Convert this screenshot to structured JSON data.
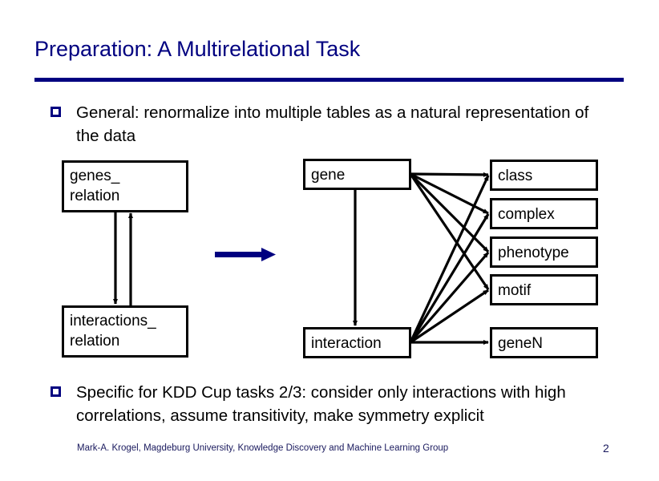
{
  "slide": {
    "title": "Preparation: A Multirelational Task",
    "accent_color": "#000080",
    "line_color": "#000000",
    "background": "#ffffff"
  },
  "bullets": [
    {
      "marker": "hollow-square",
      "text": "General: renormalize into multiple tables as a natural representation of the data"
    },
    {
      "marker": "hollow-square",
      "text": "Specific for KDD Cup tasks 2/3: consider only interactions with high correlations, assume transitivity, make symmetry explicit"
    }
  ],
  "diagram": {
    "transform_arrow": "arrow-right",
    "boxes": [
      {
        "id": "genes_relation",
        "label_line1": "genes_",
        "label_line2": "relation"
      },
      {
        "id": "interactions_relation",
        "label_line1": "interactions_",
        "label_line2": "relation"
      },
      {
        "id": "gene",
        "label_line1": "gene",
        "label_line2": ""
      },
      {
        "id": "interaction",
        "label_line1": "interaction",
        "label_line2": ""
      },
      {
        "id": "class",
        "label_line1": "class",
        "label_line2": ""
      },
      {
        "id": "complex",
        "label_line1": "complex",
        "label_line2": ""
      },
      {
        "id": "phenotype",
        "label_line1": "phenotype",
        "label_line2": ""
      },
      {
        "id": "motif",
        "label_line1": "motif",
        "label_line2": ""
      },
      {
        "id": "geneN",
        "label_line1": "geneN",
        "label_line2": ""
      }
    ],
    "connections": [
      {
        "from": "genes_relation",
        "to": "interactions_relation"
      },
      {
        "from": "interactions_relation",
        "to": "genes_relation"
      },
      {
        "from": "gene",
        "to": "interaction"
      },
      {
        "from": "gene",
        "to": "class"
      },
      {
        "from": "gene",
        "to": "complex"
      },
      {
        "from": "gene",
        "to": "phenotype"
      },
      {
        "from": "gene",
        "to": "motif"
      },
      {
        "from": "interaction",
        "to": "class"
      },
      {
        "from": "interaction",
        "to": "complex"
      },
      {
        "from": "interaction",
        "to": "phenotype"
      },
      {
        "from": "interaction",
        "to": "motif"
      },
      {
        "from": "interaction",
        "to": "geneN"
      }
    ]
  },
  "footer": {
    "credit": "Mark-A. Krogel, Magdeburg University, Knowledge Discovery and Machine Learning Group",
    "page_number": "2"
  }
}
